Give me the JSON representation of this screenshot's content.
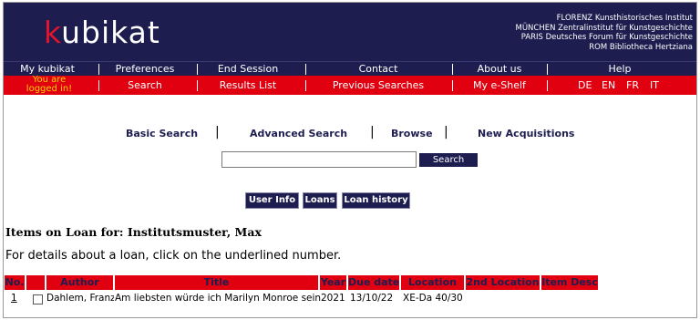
{
  "header": {
    "logo_k": "k",
    "logo_rest": "ubikat",
    "partners": [
      "FLORENZ Kunsthistorisches Institut",
      "MÜNCHEN Zentralinstitut für Kunstgeschichte",
      "PARIS Deutsches Forum für Kunstgeschichte",
      "ROM Bibliotheca Hertziana"
    ]
  },
  "nav_top": [
    "My kubikat",
    "Preferences",
    "End Session",
    "Contact",
    "About us",
    "Help"
  ],
  "nav_bottom": {
    "logged_in_line1": "You are",
    "logged_in_line2": "logged in!",
    "items": [
      "Search",
      "Results List",
      "Previous Searches",
      "My e-Shelf"
    ],
    "languages": [
      "DE",
      "EN",
      "FR",
      "IT"
    ]
  },
  "search_tabs": [
    "Basic Search",
    "Advanced Search",
    "Browse",
    "New Acquisitions"
  ],
  "search": {
    "value": "",
    "button": "Search"
  },
  "account_buttons": [
    "User Info",
    "Loans",
    "Loan history"
  ],
  "loans": {
    "heading": "Items on Loan for: Institutsmuster, Max",
    "info": "For details about a loan, click on the underlined number.",
    "columns": [
      "No.",
      "Author",
      "Title",
      "Year",
      "Due date",
      "Location",
      "2nd Location",
      "Item Desc"
    ],
    "rows": [
      {
        "no": "1",
        "author": "Dahlem, Franz",
        "title": "Am liebsten würde ich Marilyn Monroe sein",
        "year": "2021",
        "due": "13/10/22",
        "location": "XE-Da 40/30",
        "location2": "",
        "desc": ""
      }
    ]
  },
  "colors": {
    "navy": "#1d1d4f",
    "red": "#e00010",
    "yellow": "#ffd200"
  }
}
